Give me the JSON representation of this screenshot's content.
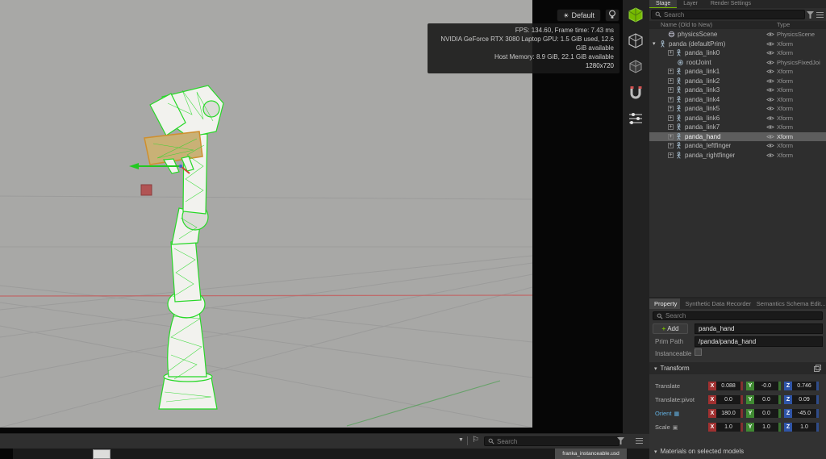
{
  "icons": {
    "sun": "☀",
    "flag": "⚐",
    "caret_down": "▼",
    "caret_expanded": "▾",
    "plus": "+",
    "grid_badge": "▦",
    "link_badge": "▣"
  },
  "viewport": {
    "camera_button_label": "Default",
    "stats": {
      "fps": "FPS: 134.60, Frame time: 7.43 ms",
      "gpu": "NVIDIA GeForce RTX 3080 Laptop GPU: 1.5 GiB used, 12.6 GiB available",
      "memory": "Host Memory: 8.9 GiB, 22.1 GiB available",
      "resolution": "1280x720"
    }
  },
  "stage_panel": {
    "tabs": [
      {
        "label": "Stage"
      },
      {
        "label": "Layer"
      },
      {
        "label": "Render Settings"
      }
    ],
    "search_placeholder": "Search",
    "columns": {
      "name": "Name (Old to New)",
      "type": "Type"
    },
    "rows": [
      {
        "label": "physicsScene",
        "type": "PhysicsScene",
        "depth": 1,
        "icon": "scene"
      },
      {
        "label": "panda (defaultPrim)",
        "type": "Xform",
        "depth": 0,
        "icon": "person",
        "expanded": true
      },
      {
        "label": "panda_link0",
        "type": "Xform",
        "depth": 1,
        "icon": "person",
        "plusbox": true
      },
      {
        "label": "rootJoint",
        "type": "PhysicsFixedJoi",
        "depth": 2,
        "icon": "joint"
      },
      {
        "label": "panda_link1",
        "type": "Xform",
        "depth": 1,
        "icon": "person",
        "plusbox": true
      },
      {
        "label": "panda_link2",
        "type": "Xform",
        "depth": 1,
        "icon": "person",
        "plusbox": true
      },
      {
        "label": "panda_link3",
        "type": "Xform",
        "depth": 1,
        "icon": "person",
        "plusbox": true
      },
      {
        "label": "panda_link4",
        "type": "Xform",
        "depth": 1,
        "icon": "person",
        "plusbox": true
      },
      {
        "label": "panda_link5",
        "type": "Xform",
        "depth": 1,
        "icon": "person",
        "plusbox": true
      },
      {
        "label": "panda_link6",
        "type": "Xform",
        "depth": 1,
        "icon": "person",
        "plusbox": true
      },
      {
        "label": "panda_link7",
        "type": "Xform",
        "depth": 1,
        "icon": "person",
        "plusbox": true
      },
      {
        "label": "panda_hand",
        "type": "Xform",
        "depth": 1,
        "icon": "person",
        "plusbox": true,
        "selected": true
      },
      {
        "label": "panda_leftfinger",
        "type": "Xform",
        "depth": 1,
        "icon": "person",
        "plusbox": true
      },
      {
        "label": "panda_rightfinger",
        "type": "Xform",
        "depth": 1,
        "icon": "person",
        "plusbox": true
      }
    ]
  },
  "property_panel": {
    "tabs": [
      {
        "label": "Property"
      },
      {
        "label": "Synthetic Data Recorder"
      },
      {
        "label": "Semantics Schema Edit..."
      }
    ],
    "search_placeholder": "Search",
    "add_button_label": "Add",
    "prim_name_value": "panda_hand",
    "prim_path_label": "Prim Path",
    "prim_path_value": "/panda/panda_hand",
    "instanceable_label": "Instanceable",
    "transform_section_label": "Transform",
    "transform_rows": [
      {
        "label": "Translate",
        "x": "0.088",
        "y": "-0.0",
        "z": "0.746"
      },
      {
        "label": "Translate:pivot",
        "x": "0.0",
        "y": "0.0",
        "z": "0.09"
      },
      {
        "label": "Orient",
        "x": "180.0",
        "y": "0.0",
        "z": "-45.0",
        "highlight": true,
        "badge_icon": "grid_badge"
      },
      {
        "label": "Scale",
        "x": "1.0",
        "y": "1.0",
        "z": "1.0",
        "badge_icon": "link_badge"
      }
    ],
    "materials_section_label": "Materials on selected models"
  },
  "bottom_bar": {
    "search_placeholder": "Search",
    "selected_file_label": "franka_instanceable.usd"
  },
  "colors": {
    "accent_green": "#76b900",
    "axis_x": "#a03030",
    "axis_y": "#3f8a32",
    "axis_z": "#2f55a8",
    "selection_wireframe_green": "#27d827",
    "hand_highlight_orange": "#cf8f2e"
  }
}
